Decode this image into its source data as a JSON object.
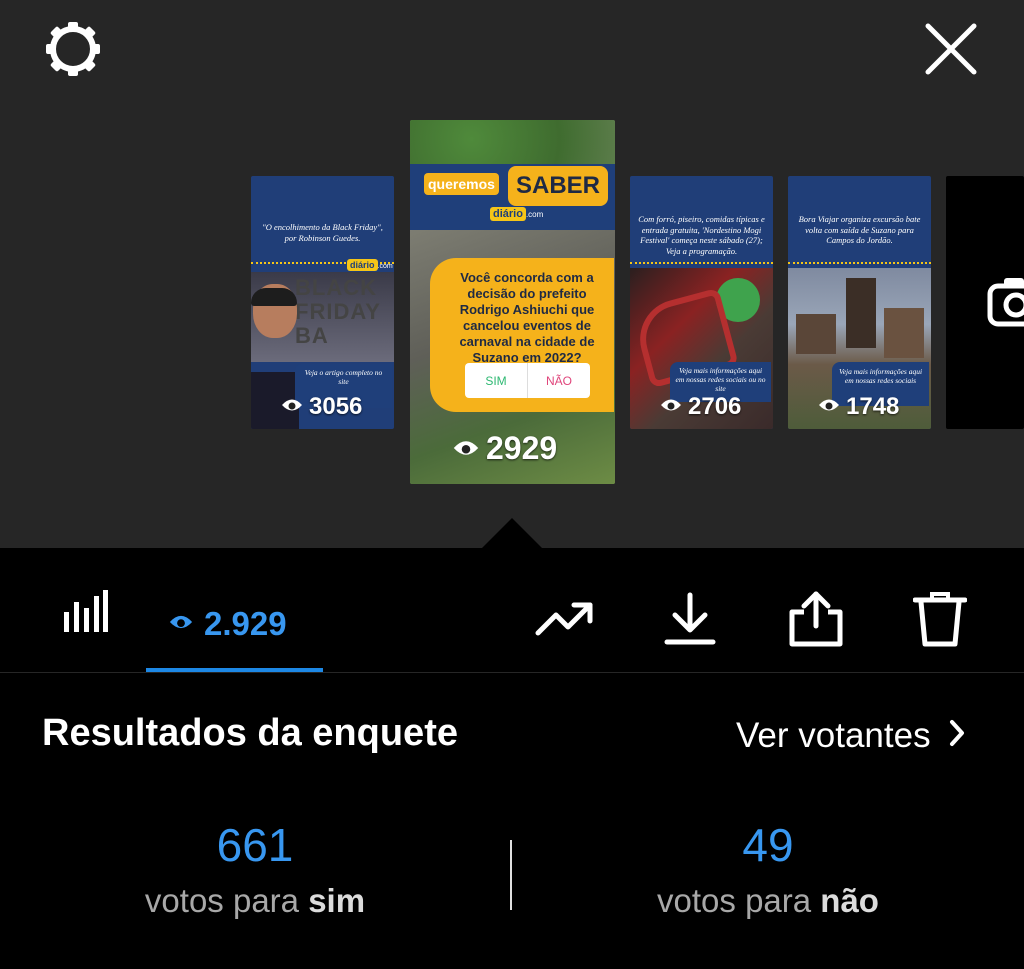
{
  "header": {
    "settings_icon": "settings-gear-icon",
    "close_icon": "close-x-icon"
  },
  "stories": [
    {
      "caption": "\"O encolhimento da Black Friday\", por Robinson Guedes.",
      "logo": "diário",
      "logo_suffix": ".com",
      "banner_text": "BLACK FRIDAY BA",
      "cta": "Veja o artigo completo no site",
      "views": "3056"
    },
    {
      "header_left": "queremos",
      "header_right": "SABER",
      "logo": "diário",
      "logo_suffix": ".com",
      "question": "Você concorda com a decisão do prefeito Rodrigo Ashiuchi que cancelou eventos de carnaval na cidade de Suzano em 2022?",
      "option_yes": "SIM",
      "option_no": "NÃO",
      "views": "2929"
    },
    {
      "caption": "Com forró, piseiro, comidas típicas e entrada gratuita, 'Nordestino Mogi Festival' começa neste sábado (27); Veja a programação.",
      "cta": "Veja mais informações aqui em nossas redes sociais ou no site",
      "views": "2706"
    },
    {
      "caption": "Bora Viajar organiza excursão bate volta com saída de Suzano para Campos do Jordão.",
      "cta": "Veja mais informações aqui em nossas redes sociais",
      "views": "1748"
    }
  ],
  "tabs": {
    "insights_icon": "bar-chart-icon",
    "views_icon": "eye-icon",
    "views_count": "2.929"
  },
  "actions": [
    "trending-up-icon",
    "download-icon",
    "share-icon",
    "trash-icon"
  ],
  "poll": {
    "title": "Resultados da enquete",
    "see_voters": "Ver votantes",
    "yes_count": "661",
    "yes_label_prefix": "votos para",
    "yes_label_option": "sim",
    "no_count": "49",
    "no_label_prefix": "votos para",
    "no_label_option": "não"
  },
  "colors": {
    "accent_blue": "#3897f0",
    "story_navy": "#1f3f7a",
    "story_yellow": "#f5b21b"
  }
}
